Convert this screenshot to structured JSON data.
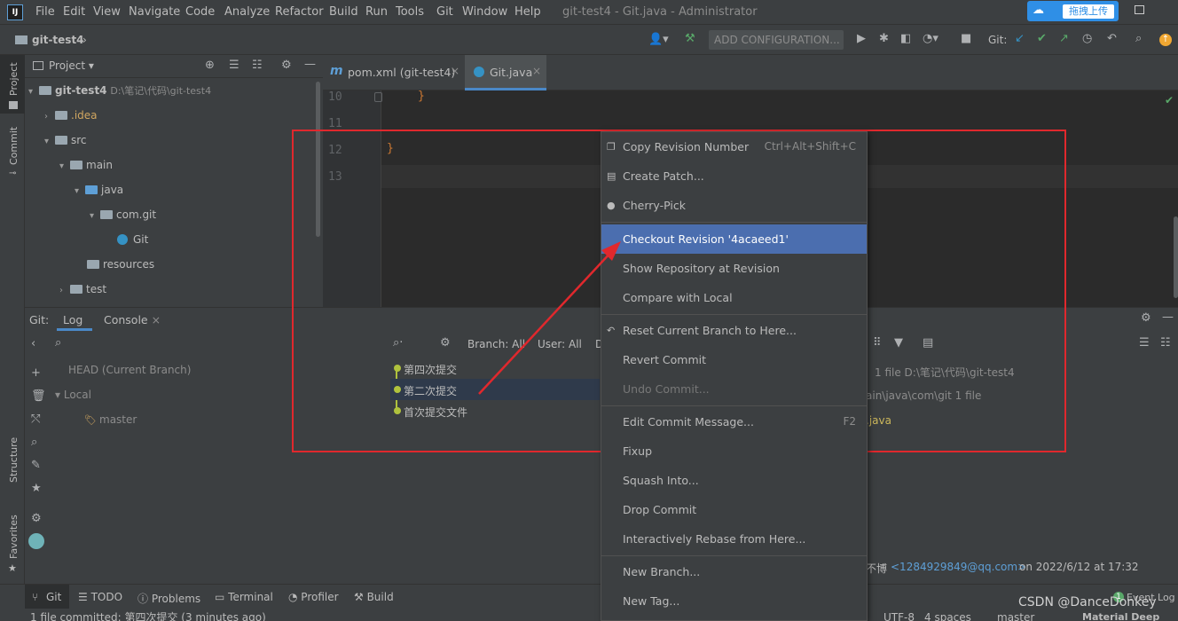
{
  "titlebar": {
    "app_icon": "IJ",
    "menus": [
      "File",
      "Edit",
      "View",
      "Navigate",
      "Code",
      "Analyze",
      "Refactor",
      "Build",
      "Run",
      "Tools",
      "Git",
      "Window",
      "Help"
    ],
    "window_title": "git-test4 - Git.java - Administrator",
    "upload_button": "拖拽上传"
  },
  "navbar": {
    "breadcrumb": "git-test4",
    "add_configuration": "ADD CONFIGURATION...",
    "git_label": "Git:"
  },
  "left_stripe": {
    "project": "Project",
    "commit": "Commit",
    "structure": "Structure",
    "favorites": "Favorites"
  },
  "project_panel": {
    "title": "Project",
    "tree": [
      {
        "label": "git-test4",
        "path": "D:\\笔记\\代码\\git-test4"
      },
      {
        "label": ".idea"
      },
      {
        "label": "src"
      },
      {
        "label": "main"
      },
      {
        "label": "java"
      },
      {
        "label": "com.git"
      },
      {
        "label": "Git"
      },
      {
        "label": "resources"
      },
      {
        "label": "test"
      }
    ]
  },
  "editor": {
    "tabs": [
      {
        "label": "pom.xml (git-test4)"
      },
      {
        "label": "Git.java"
      }
    ],
    "lines": [
      {
        "num": "10",
        "code": "}"
      },
      {
        "num": "11",
        "code": ""
      },
      {
        "num": "12",
        "code": "}"
      },
      {
        "num": "13",
        "code": ""
      }
    ]
  },
  "git_panel": {
    "prefix": "Git:",
    "tabs": [
      "Log",
      "Console"
    ],
    "branches": {
      "head": "HEAD (Current Branch)",
      "local": "Local",
      "master": "master"
    },
    "filters": {
      "branch": "Branch: All",
      "user": "User: All",
      "date": "D"
    },
    "commits": [
      "第四次提交",
      "第二次提交",
      "首次提交文件"
    ],
    "details": {
      "files_line": "1 file  D:\\笔记\\代码\\git-test4",
      "path_line": "ain\\java\\com\\git  1 file",
      "file": ".java",
      "author_prefix": "不博",
      "email": "<1284929849@qq.com>",
      "date": "on 2022/6/12 at 17:32"
    }
  },
  "context_menu": {
    "items": [
      {
        "label": "Copy Revision Number",
        "shortcut": "Ctrl+Alt+Shift+C",
        "icon": "copy-icon"
      },
      {
        "label": "Create Patch...",
        "icon": "patch-icon"
      },
      {
        "label": "Cherry-Pick",
        "icon": "cherry-icon"
      },
      {
        "label": "Checkout Revision '4acaeed1'",
        "selected": true
      },
      {
        "label": "Show Repository at Revision"
      },
      {
        "label": "Compare with Local"
      },
      {
        "label": "Reset Current Branch to Here...",
        "icon": "undo-icon"
      },
      {
        "label": "Revert Commit"
      },
      {
        "label": "Undo Commit...",
        "disabled": true
      },
      {
        "label": "Edit Commit Message...",
        "shortcut": "F2"
      },
      {
        "label": "Fixup"
      },
      {
        "label": "Squash Into..."
      },
      {
        "label": "Drop Commit"
      },
      {
        "label": "Interactively Rebase from Here..."
      },
      {
        "label": "New Branch..."
      },
      {
        "label": "New Tag..."
      }
    ]
  },
  "bottom_bar": {
    "items": [
      "Git",
      "TODO",
      "Problems",
      "Terminal",
      "Profiler",
      "Build"
    ],
    "event_log": "Event Log",
    "event_count": "1"
  },
  "status_bar": {
    "message": "1 file committed: 第四次提交 (3 minutes ago)",
    "encoding": "UTF-8",
    "indent": "4 spaces",
    "branch": "master",
    "theme": "Material Deep Ocean"
  },
  "watermark": "CSDN @DanceDonkey",
  "colors": {
    "highlight_box": "#e0282d",
    "selected_item": "#4b6eaf",
    "arrow": "#e0282d"
  }
}
